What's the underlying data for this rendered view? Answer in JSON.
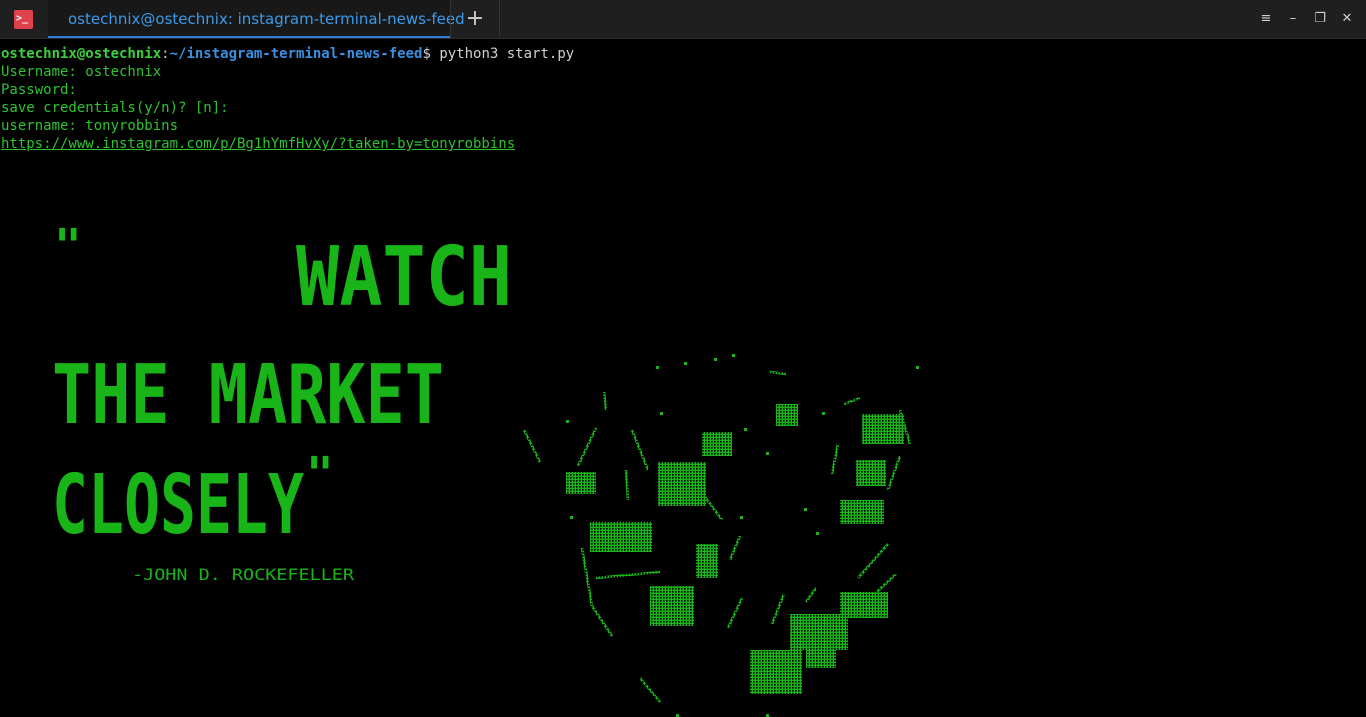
{
  "window": {
    "tab_title": "ostechnix@ostechnix: instagram-terminal-news-feed",
    "app_icon_glyph": ">_",
    "new_tab_glyph": "+",
    "menu_glyph": "≡",
    "minimize_glyph": "–",
    "maximize_glyph": "❐",
    "close_glyph": "✕"
  },
  "terminal": {
    "prompt_user": "ostechnix@ostechnix",
    "prompt_colon": ":",
    "prompt_path": "~/instagram-terminal-news-feed",
    "prompt_symbol": "$ ",
    "command": "python3 start.py",
    "lines": [
      "Username: ostechnix",
      "Password:",
      "save credentials(y/n)? [n]:",
      "username: tonyrobbins"
    ],
    "url": "https://www.instagram.com/p/Bg1hYmfHvXy/?taken-by=tonyrobbins"
  },
  "ascii_art": {
    "quote_line_1": "WATCH",
    "quote_line_2": "THE MARKET",
    "quote_line_3": "CLOSELY",
    "open_quote": "\"",
    "close_quote": "\"",
    "attribution": "-JOHN D. ROCKEFELLER"
  },
  "colors": {
    "background": "#000000",
    "text_green": "#2ec32e",
    "path_blue": "#3a8fe0",
    "tab_accent": "#2e7fd6",
    "app_icon_red": "#e0424b"
  }
}
